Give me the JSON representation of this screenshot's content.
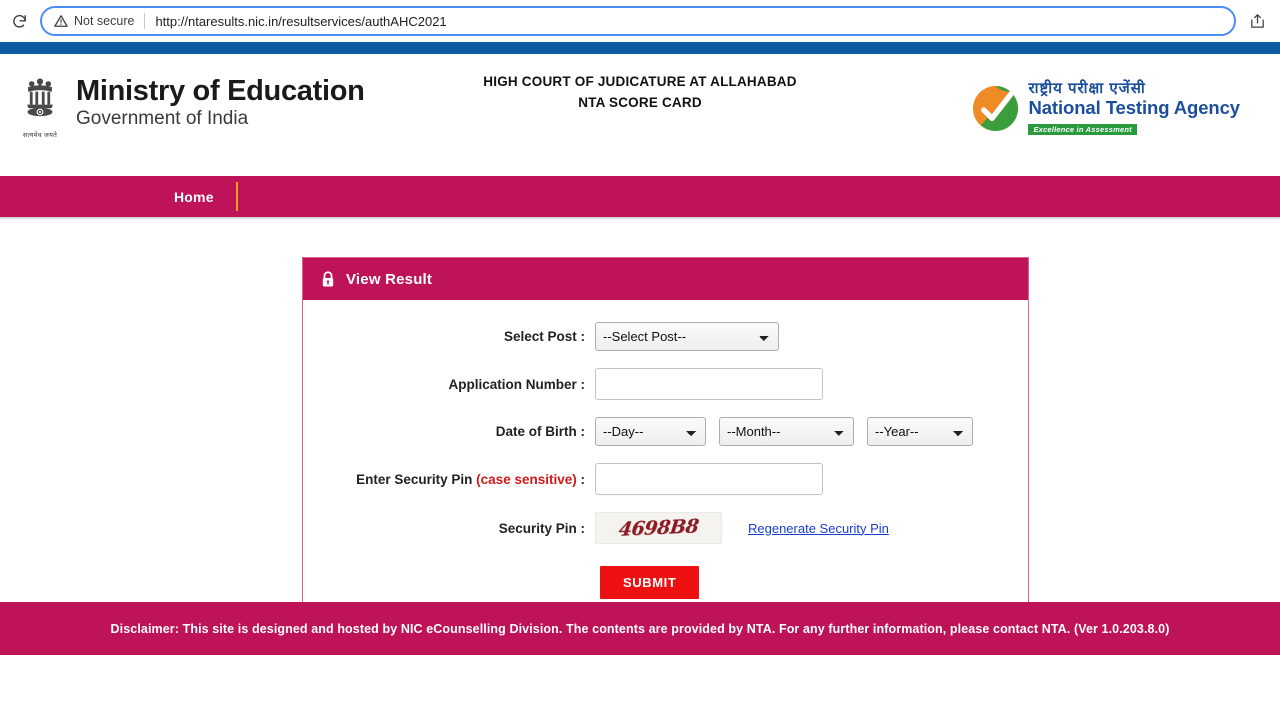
{
  "browser": {
    "reload_icon": "reload-icon",
    "security_icon": "warning-triangle-icon",
    "security_label": "Not secure",
    "url": "http://ntaresults.nic.in/resultservices/authAHC2021",
    "share_icon": "share-icon"
  },
  "header": {
    "emblem_icon": "ashoka-emblem-icon",
    "emblem_motto": "सत्यमेव जयते",
    "ministry_title": "Ministry of Education",
    "ministry_subtitle": "Government of India",
    "center_title_line1": "HIGH COURT OF JUDICATURE AT ALLAHABAD",
    "center_title_line2": "NTA SCORE CARD",
    "nta_logo_icon": "nta-checkmark-icon",
    "nta_hindi": "राष्ट्रीय परीक्षा एजेंसी",
    "nta_english": "National Testing Agency",
    "nta_tagline": "Excellence in Assessment"
  },
  "nav": {
    "items": [
      {
        "label": "Home"
      }
    ]
  },
  "panel": {
    "lock_icon": "lock-icon",
    "title": "View Result",
    "fields": {
      "post": {
        "label": "Select Post :",
        "value": "--Select Post--",
        "options": [
          "--Select Post--"
        ]
      },
      "application_number": {
        "label": "Application Number :",
        "value": "",
        "placeholder": ""
      },
      "dob": {
        "label": "Date of Birth :",
        "day": {
          "value": "--Day--",
          "options": [
            "--Day--"
          ]
        },
        "month": {
          "value": "--Month--",
          "options": [
            "--Month--"
          ]
        },
        "year": {
          "value": "--Year--",
          "options": [
            "--Year--"
          ]
        }
      },
      "security_pin_entry": {
        "label_main": "Enter Security Pin",
        "label_note": "(case sensitive)",
        "label_colon": ":",
        "value": "",
        "placeholder": ""
      },
      "security_pin_image": {
        "label": "Security Pin :",
        "captcha_text": "4698B8",
        "regenerate_label": "Regenerate Security Pin"
      }
    },
    "submit_label": "SUBMIT"
  },
  "footer": {
    "disclaimer": "Disclaimer: This site is designed and hosted by NIC eCounselling Division. The contents are provided by NTA. For any further information, please contact NTA. (Ver 1.0.203.8.0)"
  },
  "colors": {
    "magenta": "#be1259",
    "blue_strip": "#0d5ba0",
    "nta_blue": "#1b4f9c",
    "submit_red": "#ee1111",
    "accent_orange": "#f5a01e",
    "link_blue": "#1a3fcf",
    "case_sensitive_red": "#d01a1a"
  }
}
